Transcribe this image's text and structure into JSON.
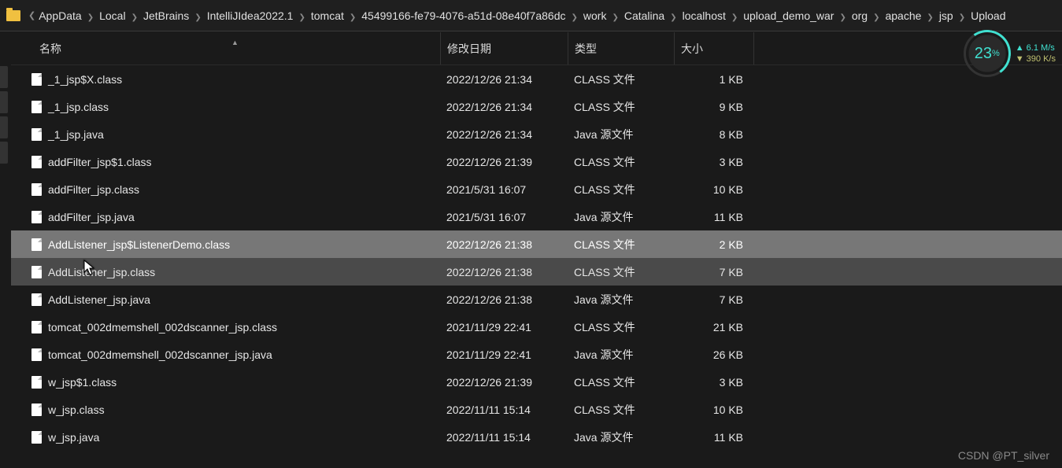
{
  "breadcrumb": [
    "AppData",
    "Local",
    "JetBrains",
    "IntelliJIdea2022.1",
    "tomcat",
    "45499166-fe79-4076-a51d-08e40f7a86dc",
    "work",
    "Catalina",
    "localhost",
    "upload_demo_war",
    "org",
    "apache",
    "jsp",
    "Upload"
  ],
  "columns": {
    "name": "名称",
    "date": "修改日期",
    "type": "类型",
    "size": "大小"
  },
  "files": [
    {
      "name": "_1_jsp$X.class",
      "date": "2022/12/26 21:34",
      "type": "CLASS 文件",
      "size": "1 KB",
      "state": ""
    },
    {
      "name": "_1_jsp.class",
      "date": "2022/12/26 21:34",
      "type": "CLASS 文件",
      "size": "9 KB",
      "state": ""
    },
    {
      "name": "_1_jsp.java",
      "date": "2022/12/26 21:34",
      "type": "Java 源文件",
      "size": "8 KB",
      "state": ""
    },
    {
      "name": "addFilter_jsp$1.class",
      "date": "2022/12/26 21:39",
      "type": "CLASS 文件",
      "size": "3 KB",
      "state": ""
    },
    {
      "name": "addFilter_jsp.class",
      "date": "2021/5/31 16:07",
      "type": "CLASS 文件",
      "size": "10 KB",
      "state": ""
    },
    {
      "name": "addFilter_jsp.java",
      "date": "2021/5/31 16:07",
      "type": "Java 源文件",
      "size": "11 KB",
      "state": ""
    },
    {
      "name": "AddListener_jsp$ListenerDemo.class",
      "date": "2022/12/26 21:38",
      "type": "CLASS 文件",
      "size": "2 KB",
      "state": "sel"
    },
    {
      "name": "AddListener_jsp.class",
      "date": "2022/12/26 21:38",
      "type": "CLASS 文件",
      "size": "7 KB",
      "state": "hov"
    },
    {
      "name": "AddListener_jsp.java",
      "date": "2022/12/26 21:38",
      "type": "Java 源文件",
      "size": "7 KB",
      "state": ""
    },
    {
      "name": "tomcat_002dmemshell_002dscanner_jsp.class",
      "date": "2021/11/29 22:41",
      "type": "CLASS 文件",
      "size": "21 KB",
      "state": ""
    },
    {
      "name": "tomcat_002dmemshell_002dscanner_jsp.java",
      "date": "2021/11/29 22:41",
      "type": "Java 源文件",
      "size": "26 KB",
      "state": ""
    },
    {
      "name": "w_jsp$1.class",
      "date": "2022/12/26 21:39",
      "type": "CLASS 文件",
      "size": "3 KB",
      "state": ""
    },
    {
      "name": "w_jsp.class",
      "date": "2022/11/11 15:14",
      "type": "CLASS 文件",
      "size": "10 KB",
      "state": ""
    },
    {
      "name": "w_jsp.java",
      "date": "2022/11/11 15:14",
      "type": "Java 源文件",
      "size": "11 KB",
      "state": ""
    }
  ],
  "net": {
    "percent": "23",
    "pct_suffix": "%",
    "up": "6.1",
    "up_unit": "M/s",
    "down": "390",
    "down_unit": "K/s"
  },
  "watermark": "CSDN @PT_silver"
}
